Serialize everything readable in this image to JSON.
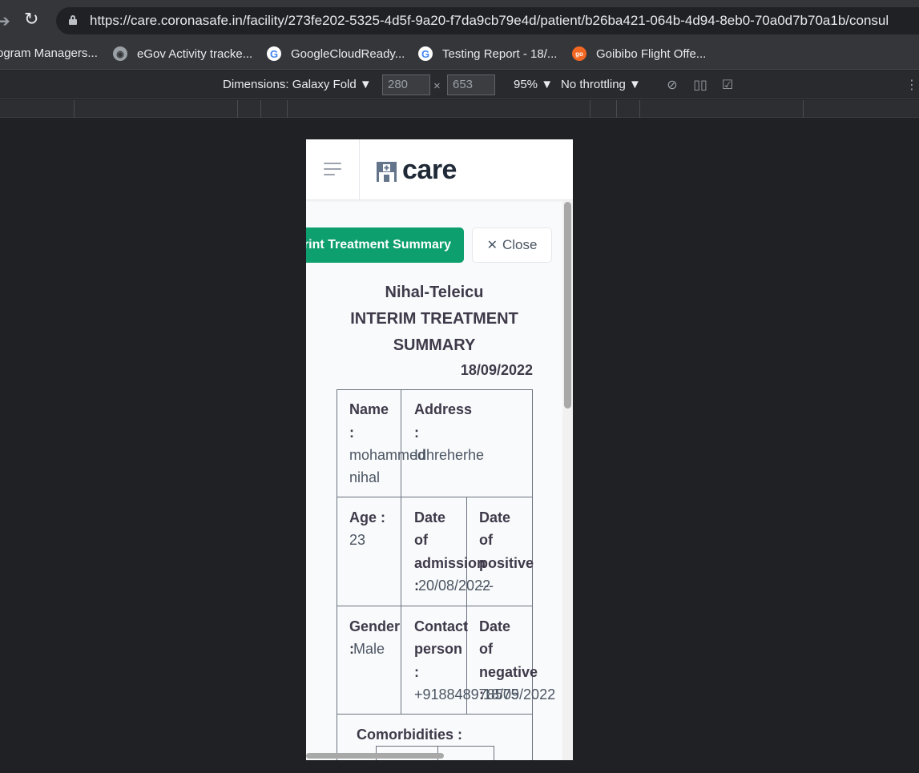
{
  "browser": {
    "url": "https://care.coronasafe.in/facility/273fe202-5325-4d5f-9a20-f7da9cb79e4d/patient/b26ba421-064b-4d94-8eb0-70a0d7b70a1b/consul",
    "bookmarks": [
      {
        "label": "ogram Managers...",
        "icon": "none"
      },
      {
        "label": "eGov Activity tracke...",
        "icon": "globe-icon"
      },
      {
        "label": "GoogleCloudReady...",
        "icon": "google-icon"
      },
      {
        "label": "Testing Report - 18/...",
        "icon": "google-icon"
      },
      {
        "label": "Goibibo Flight Offe...",
        "icon": "goibibo-icon"
      }
    ]
  },
  "devtools": {
    "dimensions_label": "Dimensions: Galaxy Fold",
    "width": "280",
    "height": "653",
    "times": "×",
    "zoom": "95%",
    "throttling": "No throttling"
  },
  "app": {
    "logo_text": "care",
    "print_button": "Print Treatment Summary",
    "close_button": "Close",
    "facility_name": "Nihal-Teleicu",
    "title_line1": "INTERIM TREATMENT",
    "title_line2": "SUMMARY",
    "date": "18/09/2022",
    "name_label_1": "Name",
    "name_label_2": ":",
    "name_value_1": "mohammed",
    "name_value_2": "nihal",
    "address_label_1": "Address",
    "address_label_2": ":",
    "address_value": "Idhreherhe",
    "age_label": "Age :",
    "age_value": "23",
    "admission_label_1": "Date",
    "admission_label_2": "of",
    "admission_label_3": "admission",
    "admission_label_4": ":",
    "admission_value": "20/08/2022",
    "positive_label_1": "Date",
    "positive_label_2": "of",
    "positive_label_3": "positive",
    "positive_value": "---",
    "gender_label_1": "Gender",
    "gender_label_2": ":",
    "gender_value": "Male",
    "contact_label_1": "Contact",
    "contact_label_2": "person",
    "contact_label_3": ":",
    "contact_value": "+918848978575",
    "negative_label_1": "Date",
    "negative_label_2": "of",
    "negative_label_3": "negative",
    "negative_label_4": ":",
    "negative_value": "18/09/2022",
    "comorbidities_label": "Comorbidities :"
  },
  "colors": {
    "primary_green": "#0d9f6e",
    "text_dark": "#3f3a4a"
  }
}
